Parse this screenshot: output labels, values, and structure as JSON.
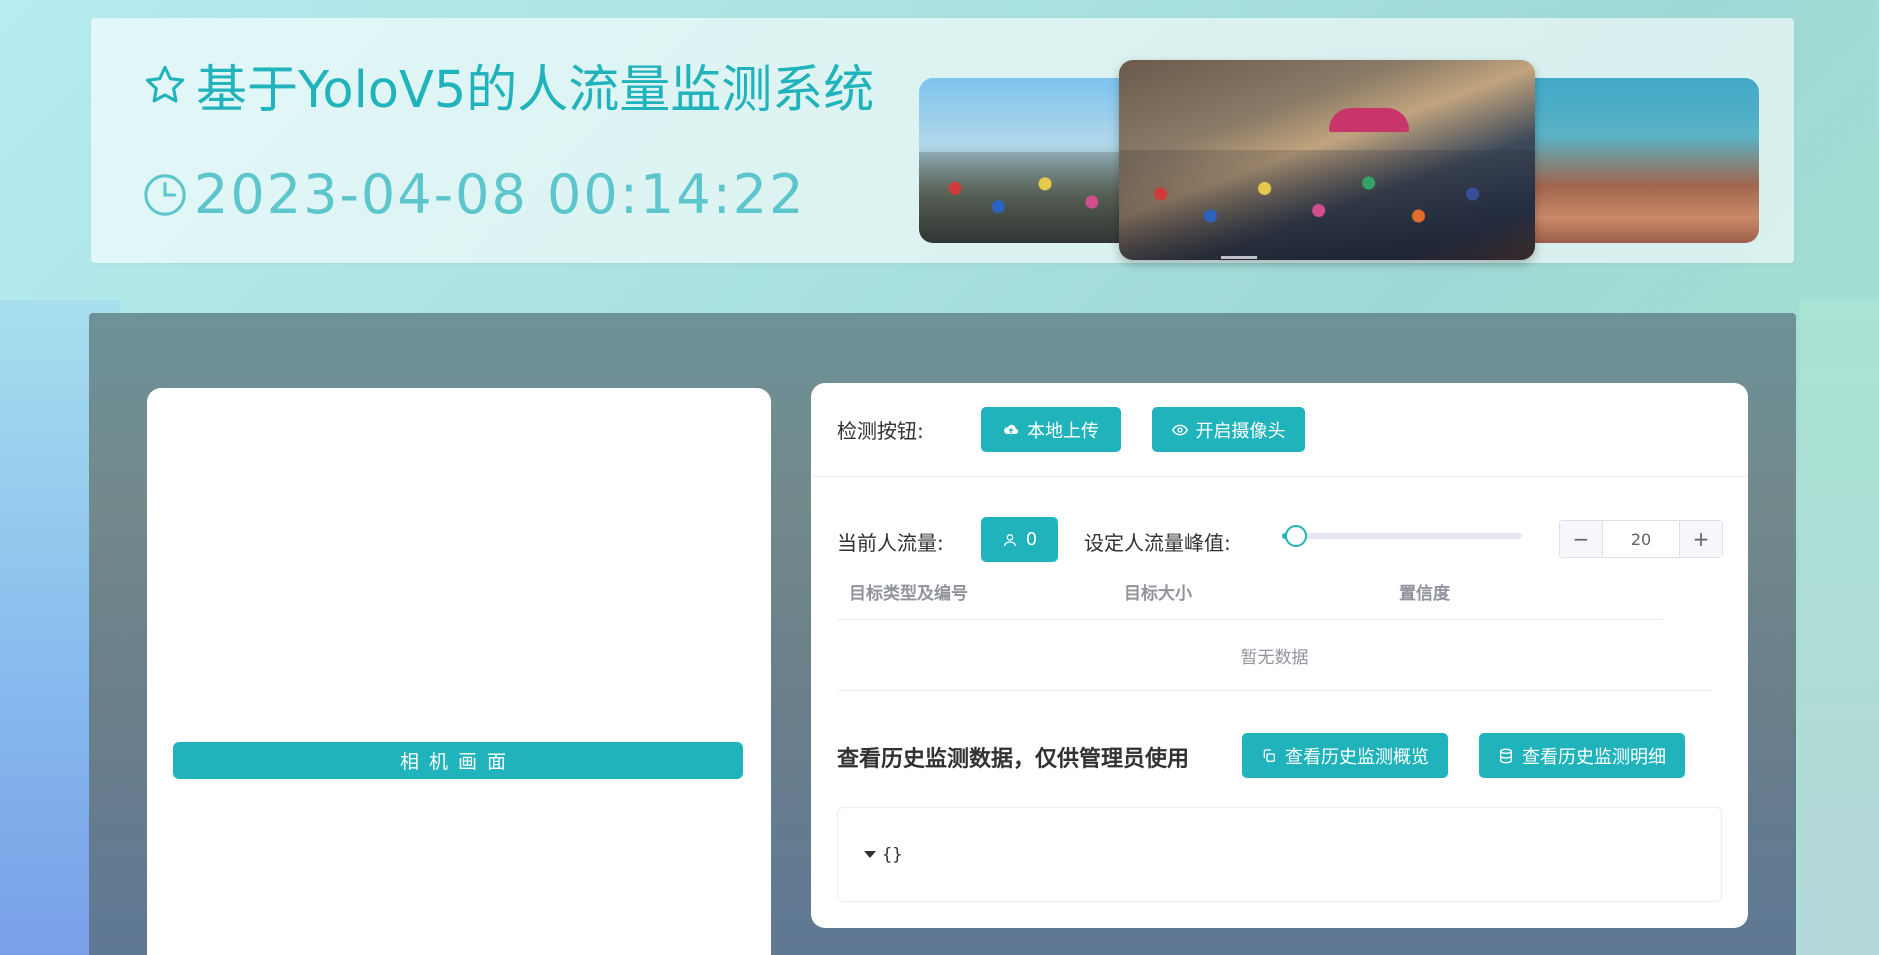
{
  "header": {
    "title": "基于YoloV5的人流量监测系统",
    "datetime": "2023-04-08 00:14:22",
    "icons": {
      "title": "star-icon",
      "time": "clock-icon"
    }
  },
  "carousel": {
    "slide_count": 3,
    "active_slide": 2
  },
  "camera": {
    "label": "相机画面"
  },
  "detect": {
    "label": "检测按钮:",
    "upload_button": "本地上传",
    "camera_button": "开启摄像头",
    "icons": {
      "upload": "cloud-upload-icon",
      "camera": "eye-icon"
    }
  },
  "flow": {
    "current_label": "当前人流量:",
    "current_count": "0",
    "peak_label": "设定人流量峰值:",
    "slider_value_fraction": 0.05,
    "peak_value": "20",
    "stepper_minus": "−",
    "stepper_plus": "+"
  },
  "table": {
    "columns": [
      "目标类型及编号",
      "目标大小",
      "置信度"
    ],
    "empty_text": "暂无数据"
  },
  "history": {
    "label": "查看历史监测数据，仅供管理员使用",
    "overview_button": "查看历史监测概览",
    "detail_button": "查看历史监测明细",
    "icons": {
      "overview": "copy-icon",
      "detail": "database-icon"
    }
  },
  "json_viewer": {
    "content": "{}"
  },
  "colors": {
    "accent": "#21b3bb",
    "title": "#21b3bb",
    "clock": "#5cc6cc",
    "panel_bg": "#ffffff"
  }
}
